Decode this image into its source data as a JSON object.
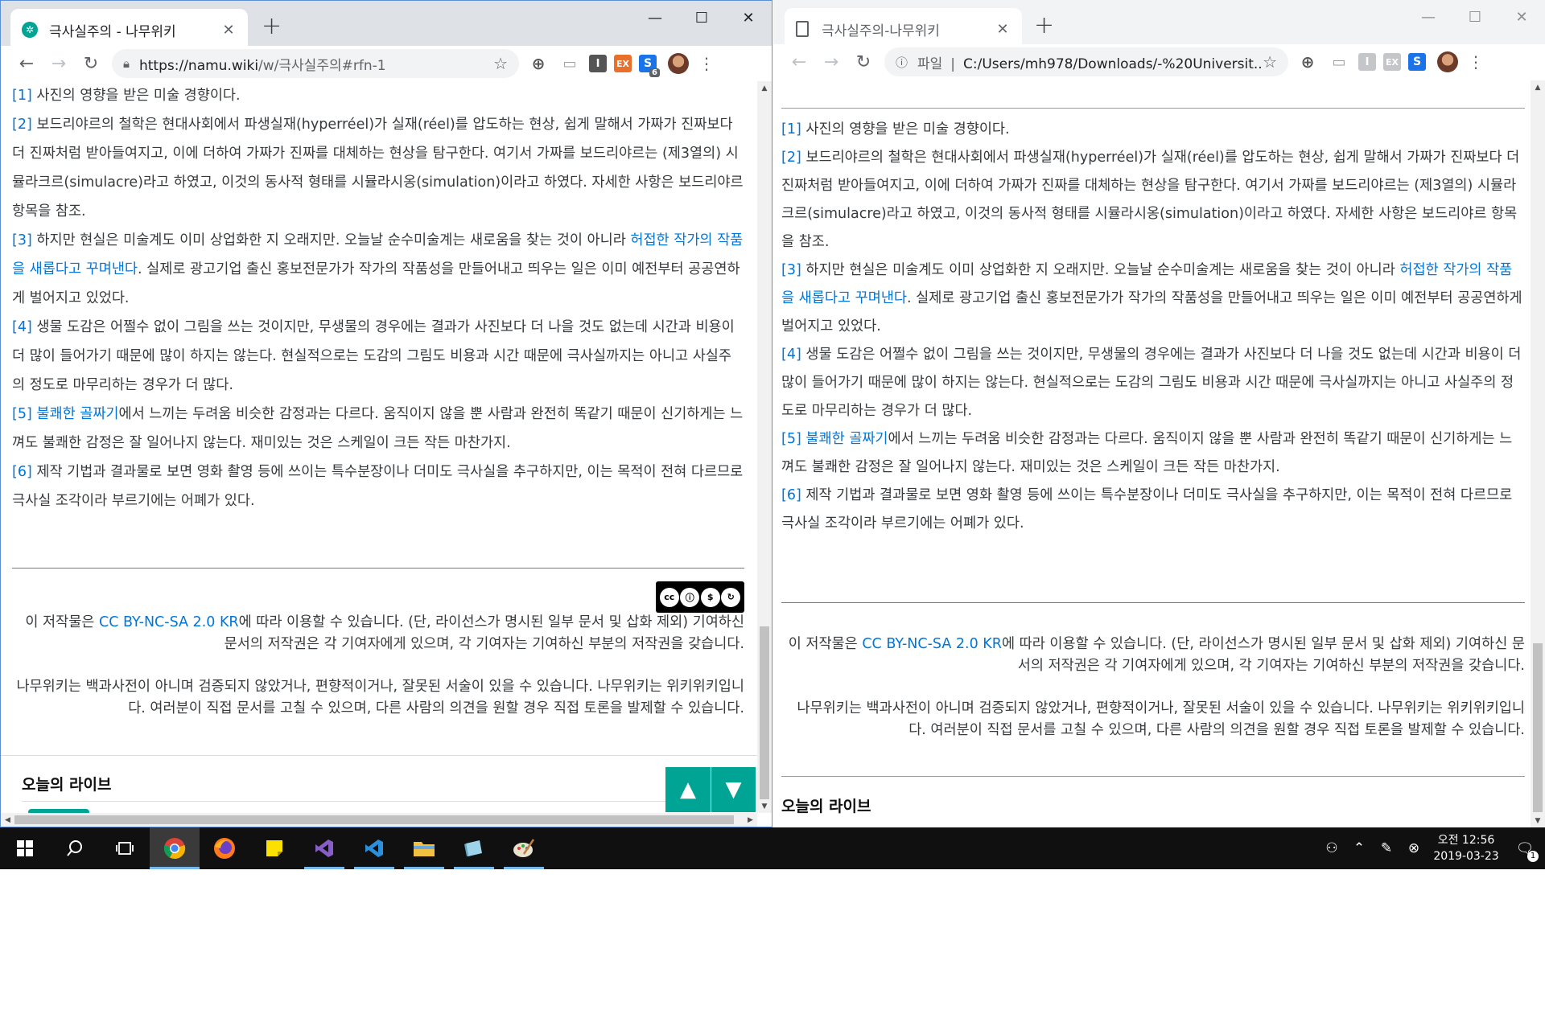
{
  "left": {
    "tab_title": "극사실주의 - 나무위키",
    "url_host": "https://namu.wiki",
    "url_path": "/w/극사실주의#rfn-1",
    "ext_badge": "6",
    "footnotes": [
      {
        "ref": "[1]",
        "parts": [
          {
            "t": "사진의 영향을 받은 미술 경향이다."
          }
        ]
      },
      {
        "ref": "[2]",
        "parts": [
          {
            "t": "보드리야르의 철학은 현대사회에서 파생실재(hyperréel)가 실재(réel)를 압도하는 현상, 쉽게 말해서 가짜가 진짜보다 더 진짜처럼 받아들여지고, 이에 더하여 가짜가 진짜를 대체하는 현상을 탐구한다. 여기서 가짜를 보드리야르는 (제3열의) 시뮬라크르(simulacre)라고 하였고, 이것의 동사적 형태를 시뮬라시옹(simulation)이라고 하였다. 자세한 사항은 보드리야르 항목을 참조."
          }
        ]
      },
      {
        "ref": "[3]",
        "parts": [
          {
            "t": "하지만 현실은 미술계도 이미 상업화한 지 오래지만. 오늘날 순수미술계는 새로움을 찾는 것이 아니라 "
          },
          {
            "t": "허접한 작가의 작품을 새롭다고 꾸며낸다",
            "link": true
          },
          {
            "t": ". 실제로 광고기업 출신 홍보전문가가 작가의 작품성을 만들어내고 띄우는 일은 이미 예전부터 공공연하게 벌어지고 있었다."
          }
        ]
      },
      {
        "ref": "[4]",
        "parts": [
          {
            "t": "생물 도감은 어쩔수 없이 그림을 쓰는 것이지만, 무생물의 경우에는 결과가 사진보다 더 나을 것도 없는데 시간과 비용이 더 많이 들어가기 때문에 많이 하지는 않는다. 현실적으로는 도감의 그림도 비용과 시간 때문에 극사실까지는 아니고 사실주의 정도로 마무리하는 경우가 더 많다."
          }
        ]
      },
      {
        "ref": "[5]",
        "parts": [
          {
            "t": "불쾌한 골짜기",
            "link": true
          },
          {
            "t": "에서 느끼는 두려움 비슷한 감정과는 다르다. 움직이지 않을 뿐 사람과 완전히 똑같기 때문이 신기하게는 느껴도 불쾌한 감정은 잘 일어나지 않는다. 재미있는 것은 스케일이 크든 작든 마찬가지."
          }
        ]
      },
      {
        "ref": "[6]",
        "parts": [
          {
            "t": "제작 기법과 결과물로 보면 영화 촬영 등에 쓰이는 특수분장이나 더미도 극사실을 추구하지만, 이는 목적이 전혀 다르므로 극사실 조각이라 부르기에는 어폐가 있다."
          }
        ]
      }
    ],
    "license_pre": "이 저작물은 ",
    "license_link": "CC BY-NC-SA 2.0 KR",
    "license_post": "에 따라 이용할 수 있습니다. (단, 라이선스가 명시된 일부 문서 및 삽화 제외) 기여하신 문서의 저작권은 각 기여자에게 있으며, 각 기여자는 기여하신 부분의 저작권을 갖습니다.",
    "disclaimer": "나무위키는 백과사전이 아니며 검증되지 않았거나, 편향적이거나, 잘못된 서술이 있을 수 있습니다. 나무위키는 위키위키입니다. 여러분이 직접 문서를 고칠 수 있으며, 다른 사람의 의견을 원할 경우 직접 토론을 발제할 수 있습니다.",
    "live_heading": "오늘의 라이브",
    "cc_badge_text": "BY NC SA"
  },
  "right": {
    "tab_title": "극사실주의-나무위키",
    "url_scheme": "파일",
    "url_path": "C:/Users/mh978/Downloads/-%20Universit...",
    "live_heading": "오늘의 라이브"
  },
  "taskbar": {
    "time": "오전 12:56",
    "date": "2019-03-23",
    "notif_count": "1",
    "apps": [
      "chrome-icon",
      "firefox-icon",
      "sticky-notes-icon",
      "visual-studio-icon",
      "vscode-icon",
      "file-explorer-icon",
      "app-icon",
      "paint-icon"
    ]
  },
  "colors": {
    "link": "#0275d8",
    "namu_green": "#00a495",
    "taskbar": "#101010"
  }
}
